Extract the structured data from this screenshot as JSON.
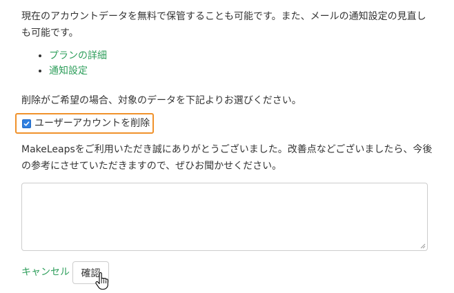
{
  "intro_text": "現在のアカウントデータを無料で保管することも可能です。また、メールの通知設定の見直しも可能です。",
  "links": [
    {
      "label": "プランの詳細"
    },
    {
      "label": "通知設定"
    }
  ],
  "delete_prompt": "削除がご希望の場合、対象のデータを下記よりお選びください。",
  "delete_option": {
    "label": "ユーザーアカウントを削除",
    "checked": true
  },
  "feedback_text": "MakeLeapsをご利用いただき誠にありがとうございました。改善点などございましたら、今後の参考にさせていただきますので、ぜひお聞かせください。",
  "feedback_field": {
    "value": "",
    "placeholder": ""
  },
  "actions": {
    "cancel_label": "キャンセル",
    "confirm_label": "確認"
  },
  "colors": {
    "link": "#2e9e5b",
    "highlight_border": "#f0912a",
    "checkbox": "#2f7fe0"
  },
  "icons": {
    "cursor": "hand-pointer-icon",
    "check": "checkmark-icon",
    "resize": "resize-grip-icon"
  }
}
